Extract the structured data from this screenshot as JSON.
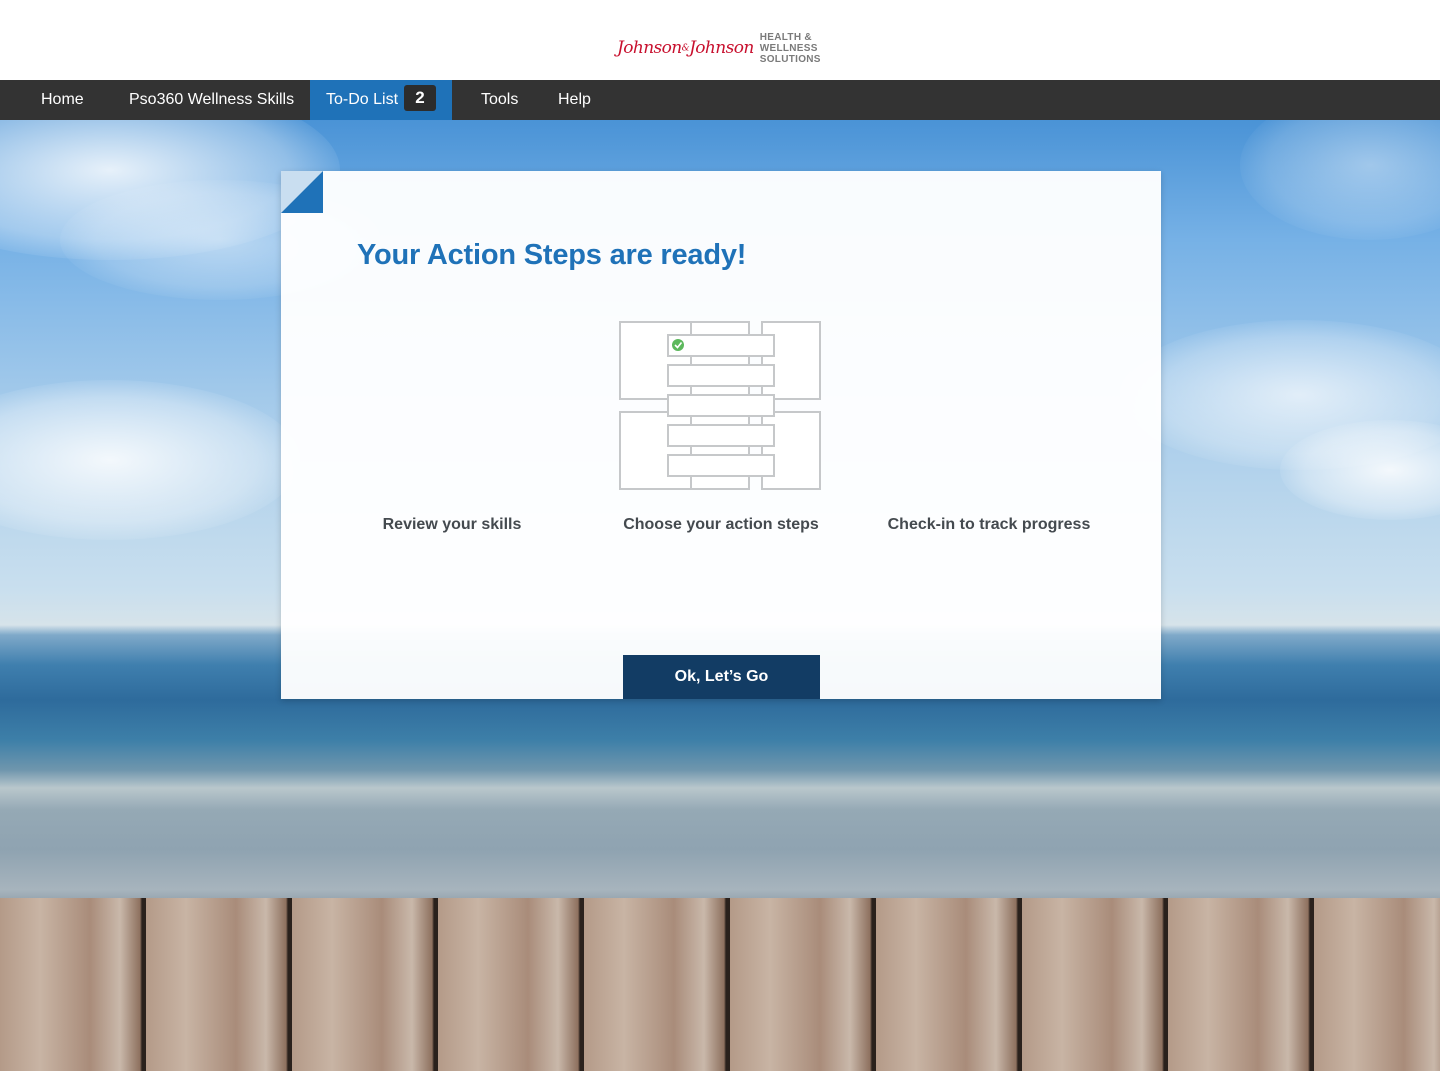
{
  "header": {
    "logo": {
      "script_text_left": "Johnson",
      "script_amp": "&",
      "script_text_right": "Johnson",
      "text_lines": [
        "HEALTH &",
        "WELLNESS",
        "SOLUTIONS"
      ]
    }
  },
  "nav": {
    "items": [
      {
        "label": "Home"
      },
      {
        "label": "Pso360 Wellness Skills"
      },
      {
        "label": "To-Do List",
        "badge": "2",
        "active": true
      },
      {
        "label": "Tools"
      },
      {
        "label": "Help"
      }
    ]
  },
  "modal": {
    "title": "Your Action Steps are ready!",
    "steps": [
      {
        "label": "Review your skills"
      },
      {
        "label": "Choose your action steps"
      },
      {
        "label": "Check-in to track progress"
      }
    ],
    "cta_label": "Ok, Let’s Go"
  },
  "colors": {
    "nav_bg": "#333333",
    "nav_active": "#1f72b8",
    "title": "#1f72b8",
    "cta_bg": "#123c64",
    "brand_red": "#c8102e"
  },
  "icons": {
    "illustration": "action-steps-illustration",
    "check": "check-circle-icon"
  }
}
